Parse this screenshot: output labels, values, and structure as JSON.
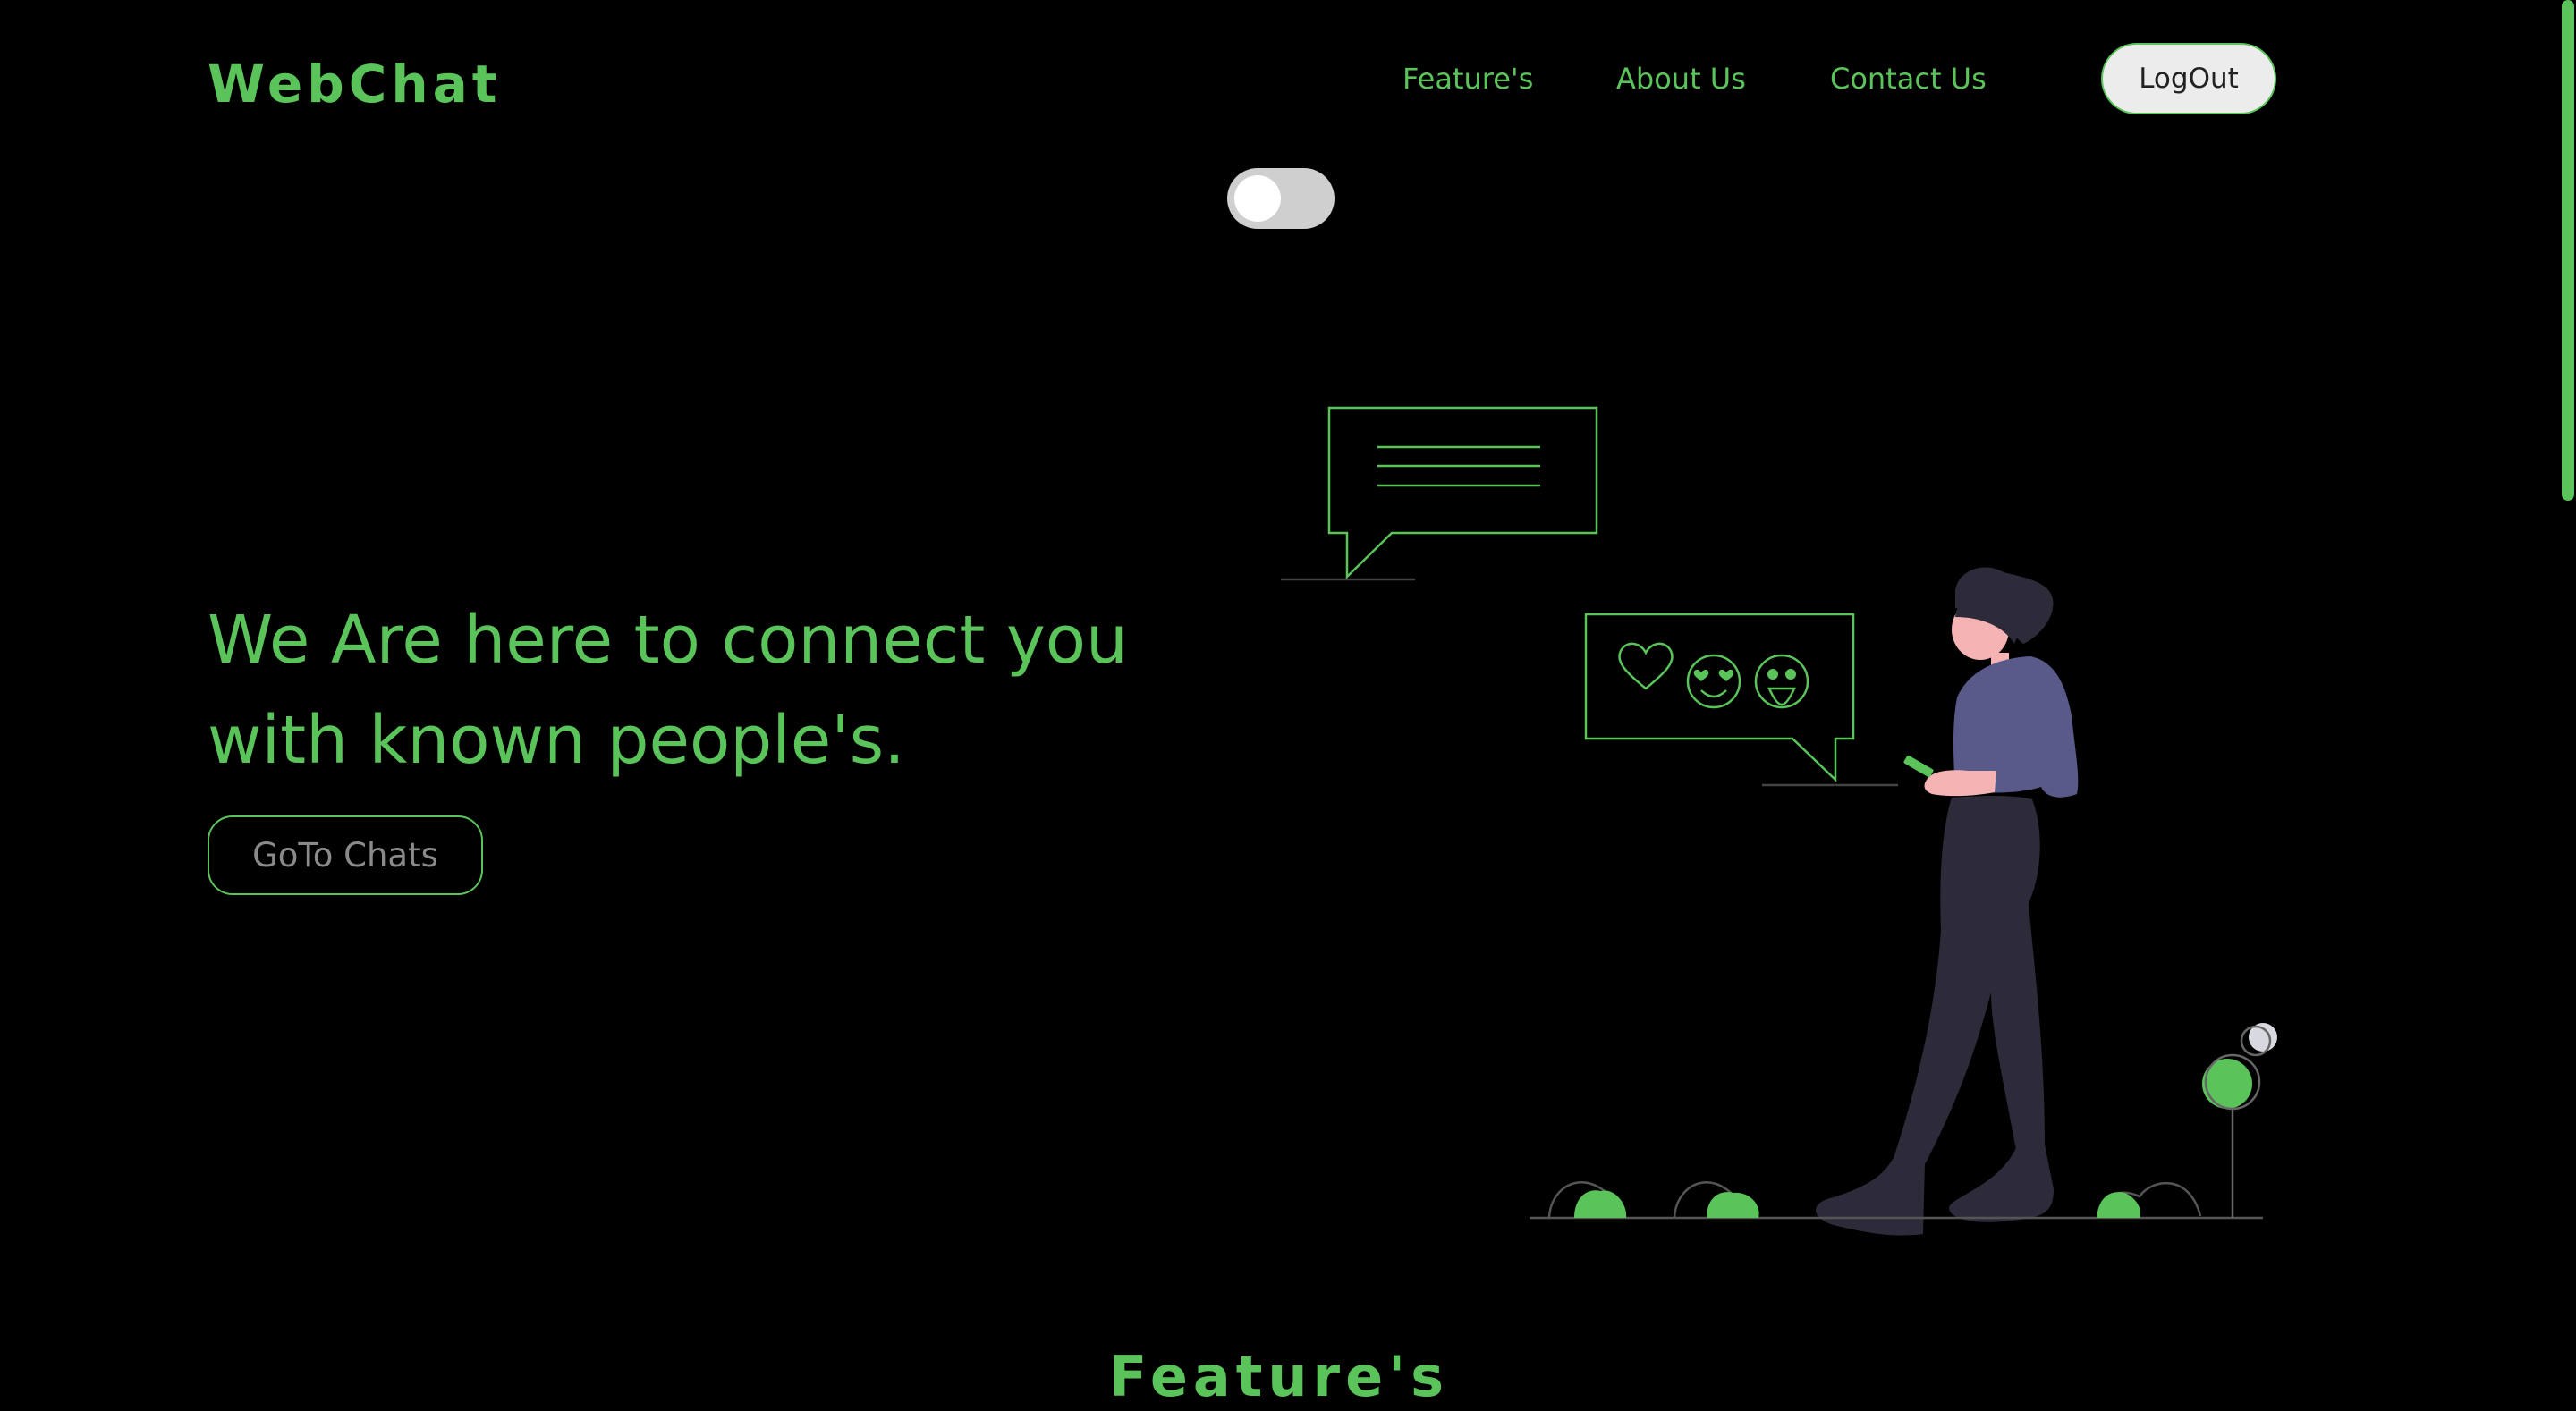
{
  "header": {
    "logo": "WebChat",
    "nav": [
      {
        "label": "Feature's"
      },
      {
        "label": "About Us"
      },
      {
        "label": "Contact Us"
      }
    ],
    "logout_label": "LogOut"
  },
  "theme_toggle": {
    "state": "off"
  },
  "hero": {
    "heading": "We Are here to connect you with known people's.",
    "cta_label": "GoTo Chats"
  },
  "features": {
    "title": "Feature's"
  },
  "colors": {
    "accent": "#5ac35a",
    "background": "#000000",
    "figure_top": "#5a5a8a",
    "figure_dark": "#2d2b3a"
  }
}
